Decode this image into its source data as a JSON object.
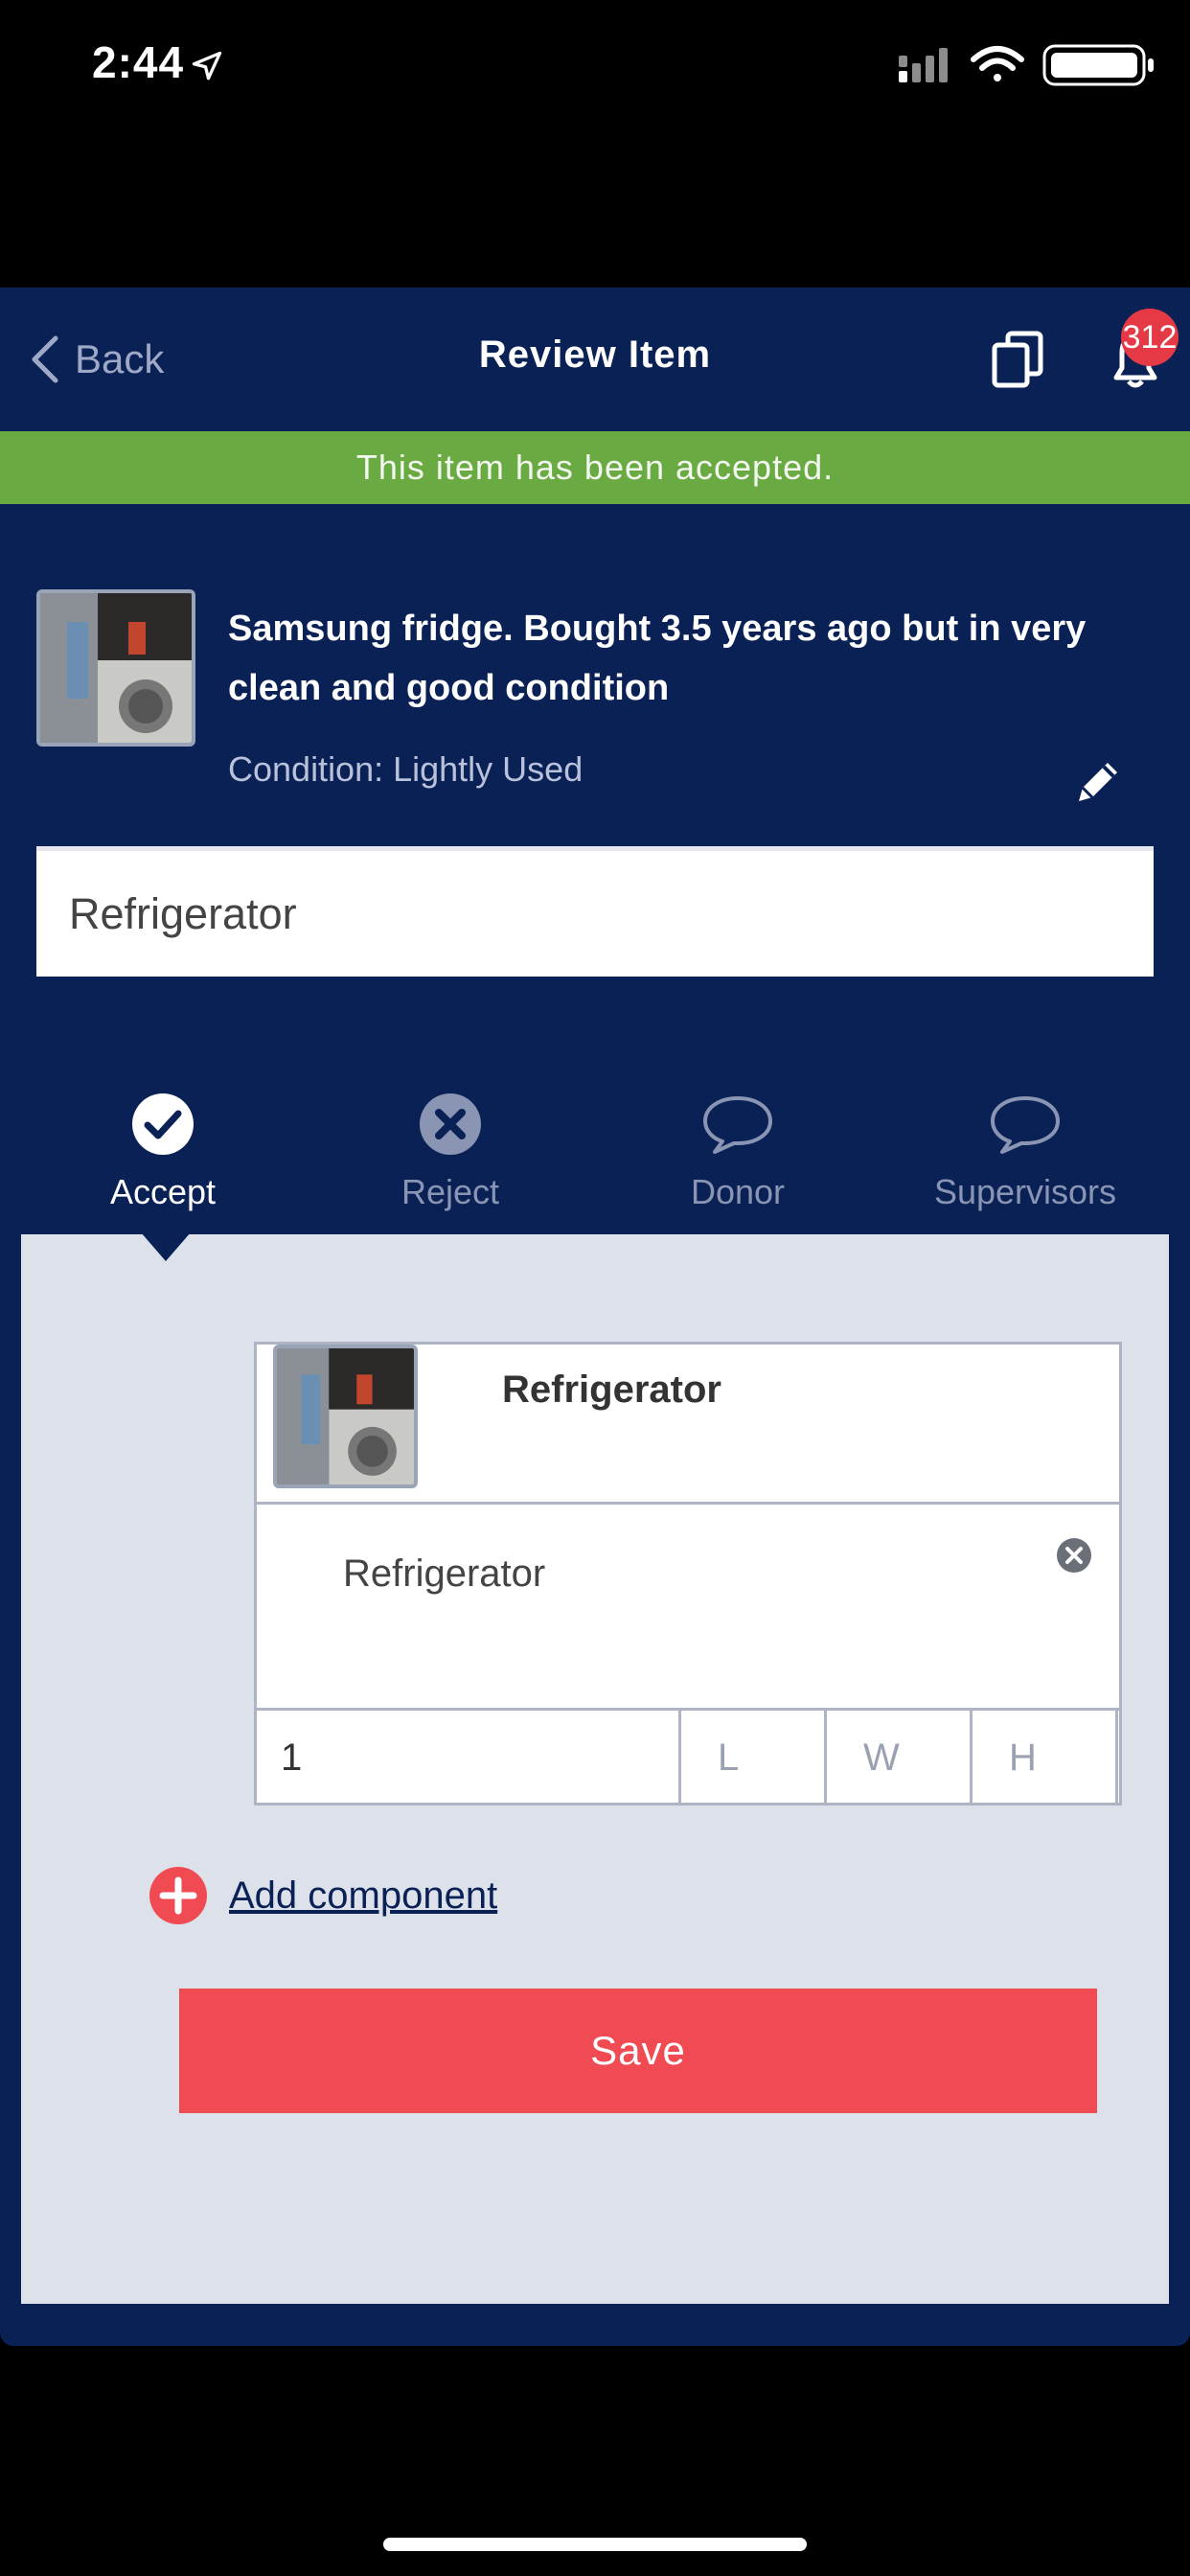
{
  "status_bar": {
    "time": "2:44"
  },
  "nav": {
    "back_label": "Back",
    "title": "Review Item",
    "notification_count": "312"
  },
  "banner": {
    "text": "This item has been accepted."
  },
  "item": {
    "description": "Samsung fridge. Bought 3.5 years ago but in very clean and good condition",
    "condition": "Condition: Lightly Used",
    "name_value": "Refrigerator"
  },
  "tabs": [
    {
      "label": "Accept",
      "icon": "check-circle-icon",
      "active": true
    },
    {
      "label": "Reject",
      "icon": "x-circle-icon",
      "active": false
    },
    {
      "label": "Donor",
      "icon": "speech-bubble-icon",
      "active": false
    },
    {
      "label": "Supervisors",
      "icon": "speech-bubble-icon",
      "active": false
    }
  ],
  "component": {
    "title": "Refrigerator",
    "description": "Refrigerator",
    "quantity": "1",
    "length_placeholder": "L",
    "width_placeholder": "W",
    "height_placeholder": "H"
  },
  "actions": {
    "add_component": "Add component",
    "save": "Save"
  },
  "colors": {
    "navy": "#0a2156",
    "accepted_green": "#6aaa43",
    "save_red": "#f04b53",
    "panel_gray": "#dde1ea",
    "badge_red": "#e63946"
  }
}
